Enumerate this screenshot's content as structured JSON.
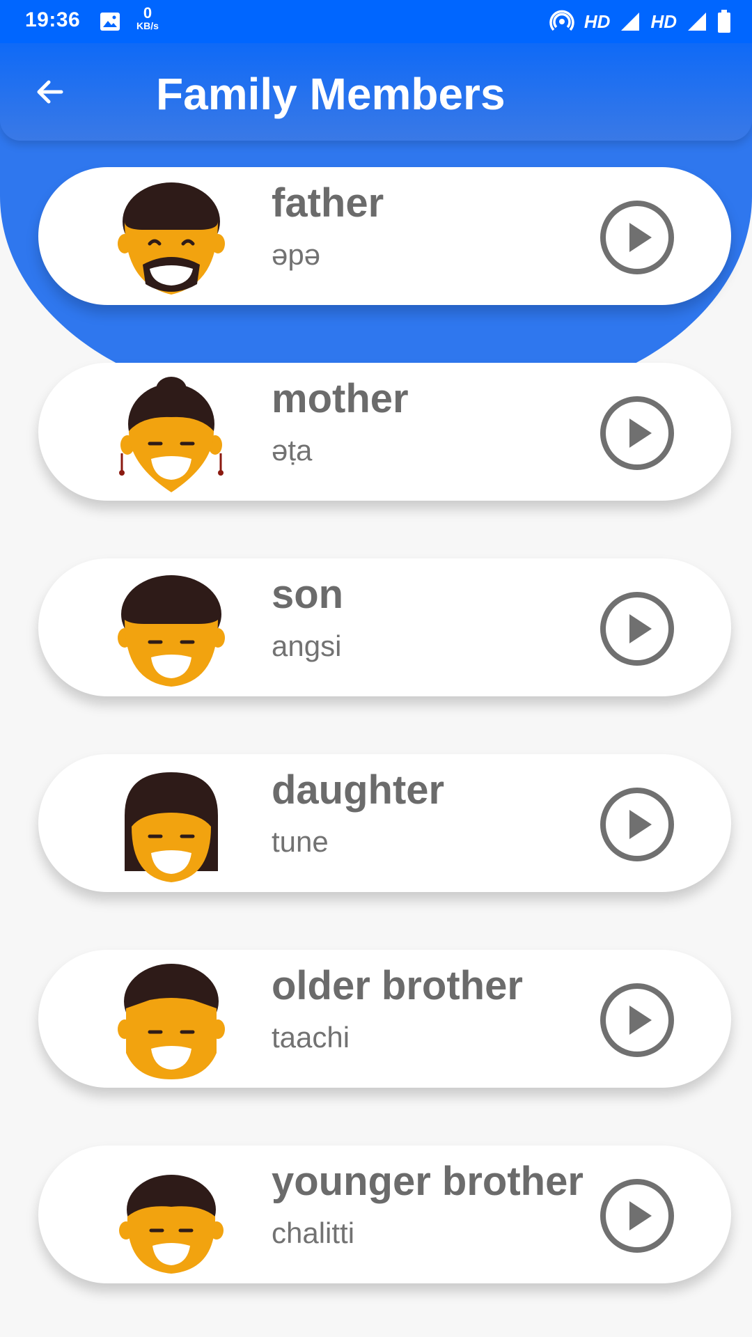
{
  "status_bar": {
    "time": "19:36",
    "network_speed_value": "0",
    "network_speed_unit": "KB/s",
    "hd_label_1": "HD",
    "hd_label_2": "HD"
  },
  "app_bar": {
    "title": "Family Members",
    "back_icon": "arrow-left-icon"
  },
  "colors": {
    "status_bar": "#0066ff",
    "app_bar": "#2f77ee",
    "text_primary": "#6b6b6b",
    "face_skin": "#f2a30f",
    "hair": "#2e1b18"
  },
  "items": [
    {
      "word": "father",
      "translation": "əpə",
      "avatar": "father-face-icon"
    },
    {
      "word": "mother",
      "translation": "əṭa",
      "avatar": "mother-face-icon"
    },
    {
      "word": "son",
      "translation": "angsi",
      "avatar": "son-face-icon"
    },
    {
      "word": "daughter",
      "translation": "tune",
      "avatar": "daughter-face-icon"
    },
    {
      "word": "older brother",
      "translation": "taachi",
      "avatar": "older-brother-face-icon"
    },
    {
      "word": "younger brother",
      "translation": "chalitti",
      "avatar": "younger-brother-face-icon"
    }
  ]
}
